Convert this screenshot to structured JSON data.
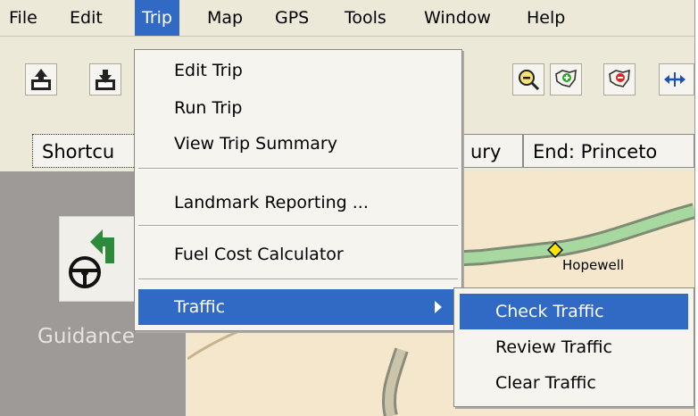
{
  "menubar": {
    "items": [
      "File",
      "Edit",
      "Trip",
      "Map",
      "GPS",
      "Tools",
      "Window",
      "Help"
    ],
    "active": "Trip"
  },
  "toolbar": {
    "buttons": [
      "upload-icon",
      "download-icon",
      "zoom-out-icon",
      "add-region-icon",
      "remove-region-icon",
      "pan-icon"
    ]
  },
  "tabs": {
    "shortcuts": "Shortcu",
    "start": "ury",
    "end": "End: Princeto"
  },
  "shortcuts_panel": {
    "guidance_label": "Guidance"
  },
  "map": {
    "city": "Hopewell"
  },
  "trip_menu": {
    "edit_trip": "Edit Trip",
    "run_trip": "Run Trip",
    "view_summary": "View Trip Summary",
    "landmark": "Landmark Reporting ...",
    "fuel": "Fuel Cost Calculator",
    "traffic": "Traffic"
  },
  "traffic_submenu": {
    "check": "Check Traffic",
    "review": "Review Traffic",
    "clear": "Clear Traffic"
  },
  "colors": {
    "highlight": "#316ac5",
    "menu_bg": "#f5f4ef",
    "chrome": "#ece9d8"
  }
}
